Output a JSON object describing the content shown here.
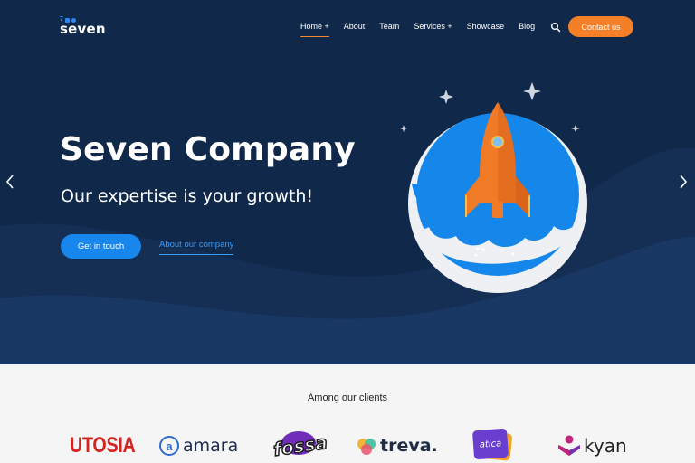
{
  "brand": {
    "logo_prefix": "7",
    "name": "seven"
  },
  "nav": {
    "items": [
      {
        "label": "Home +",
        "active": true
      },
      {
        "label": "About"
      },
      {
        "label": "Team"
      },
      {
        "label": "Services +"
      },
      {
        "label": "Showcase"
      },
      {
        "label": "Blog"
      }
    ],
    "contact_label": "Contact us"
  },
  "hero": {
    "title": "Seven Company",
    "subtitle": "Our expertise is your growth!",
    "primary_cta": "Get in touch",
    "secondary_cta": "About our company"
  },
  "clients": {
    "title": "Among our clients",
    "logos": [
      {
        "name": "UTOSIA",
        "color": "#d4231f"
      },
      {
        "name": "amara",
        "color": "#1d2a4f"
      },
      {
        "name": "fossa",
        "color": "#1a1a1a"
      },
      {
        "name": "treva.",
        "color": "#1f2d44"
      },
      {
        "name": "atica",
        "color": "#6a3fd0"
      },
      {
        "name": "kyan",
        "color": "#222222"
      }
    ]
  },
  "colors": {
    "hero_bg": "#10284a",
    "accent_orange": "#f47f27",
    "accent_blue": "#1787ed"
  }
}
